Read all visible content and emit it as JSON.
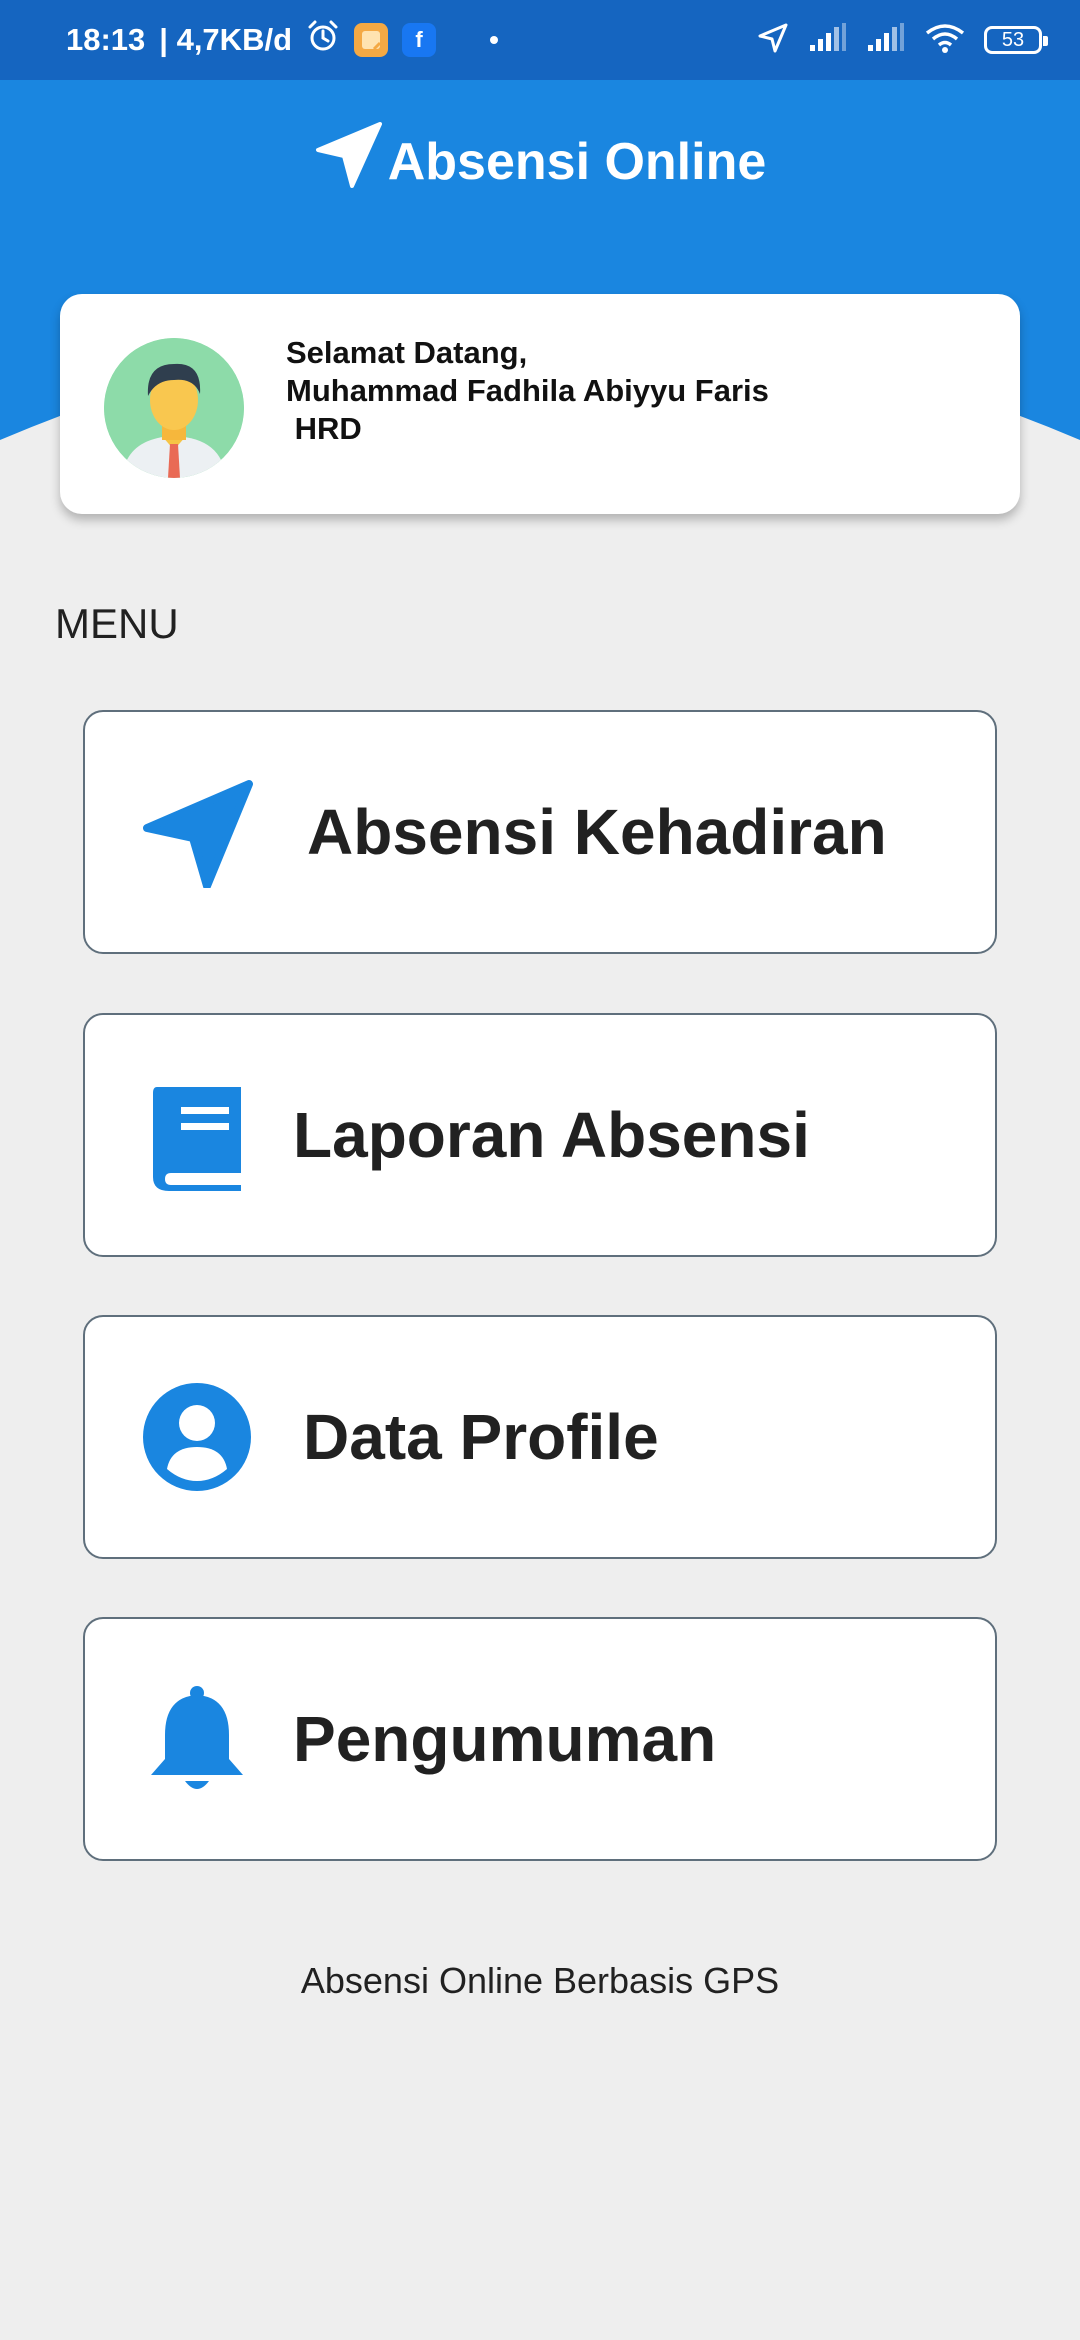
{
  "status_bar": {
    "time": "18:13",
    "speed": "| 4,7KB/d",
    "battery": "53",
    "facebook_letter": "f"
  },
  "header": {
    "title": "Absensi Online"
  },
  "welcome": {
    "greeting": "Selamat Datang,",
    "name": "Muhammad Fadhila Abiyyu Faris",
    "role": " HRD"
  },
  "menu": {
    "heading": "MENU",
    "items": [
      {
        "label": "Absensi Kehadiran",
        "icon": "navigation-arrow-icon"
      },
      {
        "label": "Laporan Absensi",
        "icon": "book-icon"
      },
      {
        "label": "Data Profile",
        "icon": "user-circle-icon"
      },
      {
        "label": "Pengumuman",
        "icon": "bell-icon"
      }
    ]
  },
  "footer": {
    "text": "Absensi Online Berbasis GPS"
  },
  "colors": {
    "primary": "#1a86e0",
    "status_bar": "#1565c0",
    "background": "#eeeeee"
  }
}
